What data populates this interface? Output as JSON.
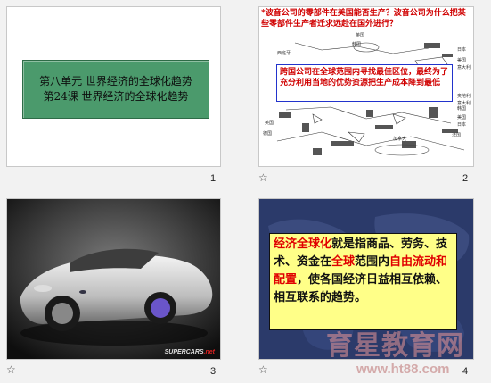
{
  "slides": [
    {
      "number": "1",
      "title_line1": "第八单元  世界经济的全球化趋势",
      "title_line2": "第24课  世界经济的全球化趋势"
    },
    {
      "number": "2",
      "question": "波音公司的零部件在美国能否生产？波音公司为什么把某些零部件生产者迁求远赴在国外进行？",
      "answer": "跨国公司在全球范围内寻找最佳区位，最终为了充分利用当地的优势资源把生产成本降到最低",
      "countries": [
        "英国",
        "韩国",
        "西班牙",
        "日本",
        "美国",
        "意大利",
        "韩国",
        "英国",
        "德国",
        "美国",
        "意大利",
        "加拿大",
        "法国",
        "奥地利",
        "日本"
      ]
    },
    {
      "number": "3",
      "brand_main": "SUPERCARS",
      "brand_sub": ".net"
    },
    {
      "number": "4",
      "seg": [
        "经济全球化",
        "就是指商品、劳务、技术、资金在",
        "全球",
        "范围内",
        "自由流动和配置",
        "，使各国经济日益相互依赖、相互联系的趋势。"
      ]
    }
  ],
  "star_icon": "☆",
  "watermark": {
    "main": "育星教育网",
    "url": "www.ht88.com"
  },
  "colors": {
    "title_box": "#4b9a6c",
    "answer_border": "#2233cc",
    "highlight_bg": "#ffff88",
    "emphasis": "#e00000",
    "slide4_bg": "#2b3a6a"
  }
}
